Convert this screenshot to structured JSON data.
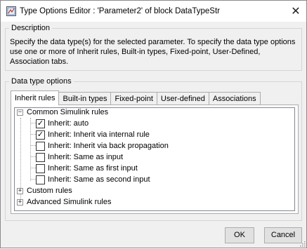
{
  "window": {
    "title": "Type Options Editor : 'Parameter2' of block DataTypeStr",
    "close_glyph": "✕"
  },
  "description": {
    "legend": "Description",
    "text": "Specify the data type(s) for the selected parameter. To specify the data type options use one or more of Inherit rules, Built-in types, Fixed-point, User-Defined, Association tabs."
  },
  "options": {
    "legend": "Data type options",
    "tabs": [
      {
        "label": "Inherit rules",
        "active": true
      },
      {
        "label": "Built-in types",
        "active": false
      },
      {
        "label": "Fixed-point",
        "active": false
      },
      {
        "label": "User-defined",
        "active": false
      },
      {
        "label": "Associations",
        "active": false
      }
    ],
    "tree": {
      "common": {
        "label": "Common Simulink rules",
        "expander": "−",
        "expanded": true
      },
      "items": [
        {
          "label": "Inherit: auto",
          "checked": true,
          "mark": "✓"
        },
        {
          "label": "Inherit: Inherit via internal rule",
          "checked": true,
          "mark": "✓"
        },
        {
          "label": "Inherit: Inherit via back propagation",
          "checked": false,
          "mark": ""
        },
        {
          "label": "Inherit: Same as input",
          "checked": false,
          "mark": ""
        },
        {
          "label": "Inherit: Same as first input",
          "checked": false,
          "mark": ""
        },
        {
          "label": "Inherit: Same as second input",
          "checked": false,
          "mark": ""
        }
      ],
      "custom": {
        "label": "Custom rules",
        "expander": "+",
        "expanded": false
      },
      "advanced": {
        "label": "Advanced Simulink rules",
        "expander": "+",
        "expanded": false
      }
    }
  },
  "buttons": {
    "ok": "OK",
    "cancel": "Cancel"
  },
  "icons": {
    "app": "matlab-block-icon",
    "close": "close-icon",
    "grip": "resize-grip-icon"
  }
}
